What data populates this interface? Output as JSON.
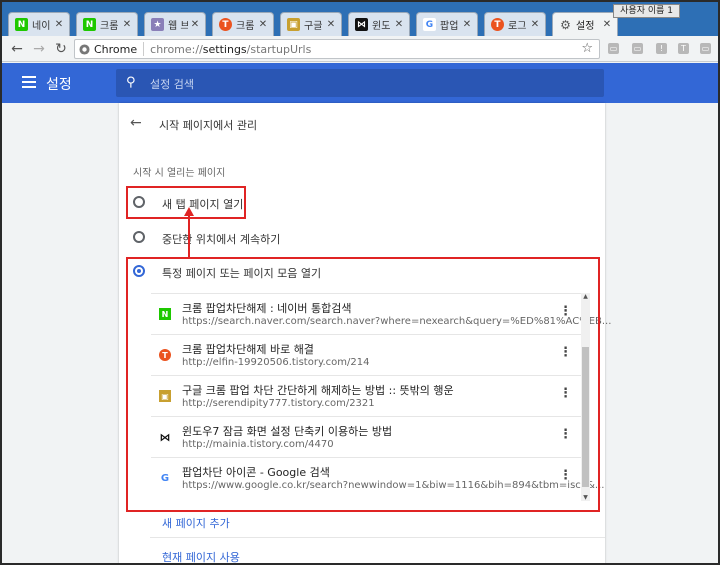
{
  "tabs": [
    {
      "label": "네이",
      "favicon": "N",
      "color": "#1ec800"
    },
    {
      "label": "크롬",
      "favicon": "N",
      "color": "#1ec800"
    },
    {
      "label": "웹 브",
      "favicon": "★",
      "color": "#8a7fb8"
    },
    {
      "label": "크롬",
      "favicon": "T",
      "color": "#eb531f"
    },
    {
      "label": "구글",
      "favicon": "▣",
      "color": "#c8a030"
    },
    {
      "label": "윈도",
      "favicon": "⋈",
      "color": "#111111"
    },
    {
      "label": "팝업",
      "favicon": "G",
      "color": "#4285f4"
    },
    {
      "label": "로그",
      "favicon": "T",
      "color": "#eb531f"
    },
    {
      "label": "설정",
      "favicon": "⚙",
      "color": "#555555"
    }
  ],
  "tab_close": "✕",
  "profile_button": "사용자 이름 1",
  "toolbar": {
    "back": "←",
    "forward": "→",
    "reload": "↻",
    "site_label": "Chrome",
    "url_prefix": "chrome://",
    "url_host": "settings",
    "url_path": "/startupUrls",
    "star": "☆",
    "extensions": [
      "▭",
      "▭",
      "!",
      "T",
      "▭"
    ]
  },
  "header": {
    "title": "설정",
    "search_placeholder": "설정 검색"
  },
  "subpage": {
    "back": "←",
    "title": "시작 페이지에서 관리",
    "section_label": "시작 시 열리는 페이지"
  },
  "startup_options": [
    {
      "label": "새 탭 페이지 열기",
      "checked": false
    },
    {
      "label": "중단한 위치에서 계속하기",
      "checked": false
    },
    {
      "label": "특정 페이지 또는 페이지 모음 열기",
      "checked": true
    }
  ],
  "pages": [
    {
      "title": "크롬 팝업차단해제 : 네이버 통합검색",
      "url": "https://search.naver.com/search.naver?where=nexearch&query=%ED%81%AC%EB...",
      "favicon": "N",
      "color": "#1ec800"
    },
    {
      "title": "크롬 팝업차단해제 바로 해결",
      "url": "http://elfin-19920506.tistory.com/214",
      "favicon": "T",
      "color": "#eb531f"
    },
    {
      "title": "구글 크롬 팝업 차단 간단하게 해제하는 방법 :: 뜻밖의 행운",
      "url": "http://serendipity777.tistory.com/2321",
      "favicon": "▣",
      "color": "#c8a030"
    },
    {
      "title": "윈도우7 잠금 화면 설정 단축키 이용하는 방법",
      "url": "http://mainia.tistory.com/4470",
      "favicon": "⋈",
      "color": "#111111"
    },
    {
      "title": "팝업차단 아이콘 - Google 검색",
      "url": "https://www.google.co.kr/search?newwindow=1&biw=1116&bih=894&tbm=isch&...",
      "favicon": "G",
      "color": "#4285f4"
    }
  ],
  "more_menu": "⋮",
  "links": {
    "add_page": "새 페이지 추가",
    "use_current": "현재 페이지 사용"
  },
  "scroll_up": "▲",
  "scroll_down": "▼",
  "accent_color": "#3367d6",
  "annotation_color": "#e02424"
}
